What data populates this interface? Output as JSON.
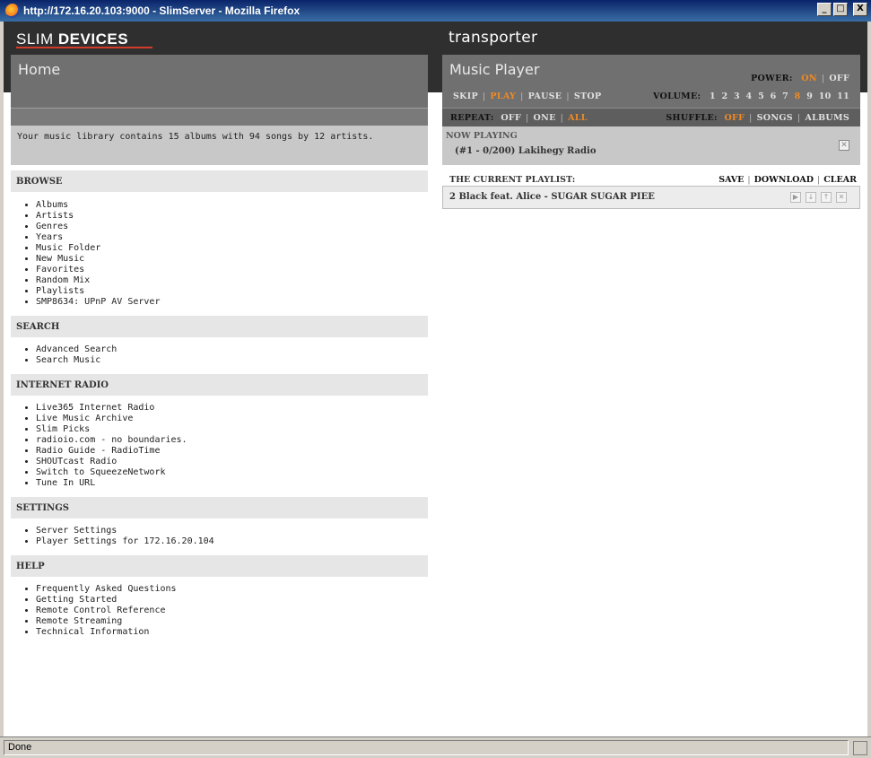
{
  "window": {
    "title": "http://172.16.20.103:9000 - SlimServer - Mozilla Firefox",
    "buttons": [
      "_",
      "□",
      "X"
    ]
  },
  "branding": {
    "logo_light": "SLIM ",
    "logo_bold": "DEVICES",
    "product": "transporter"
  },
  "home": {
    "title": "Home",
    "library_text": "Your music library contains 15 albums with 94 songs by 12 artists."
  },
  "sections": {
    "browse": {
      "title": "BROWSE",
      "items": [
        "Albums",
        "Artists",
        "Genres",
        "Years",
        "Music Folder",
        "New Music",
        "Favorites",
        "Random Mix",
        "Playlists",
        "SMP8634: UPnP AV Server"
      ]
    },
    "search": {
      "title": "SEARCH",
      "items": [
        "Advanced Search",
        "Search Music"
      ]
    },
    "internet_radio": {
      "title": "INTERNET RADIO",
      "items": [
        "Live365 Internet Radio",
        "Live Music Archive",
        "Slim Picks",
        "radioio.com - no boundaries.",
        "Radio Guide - RadioTime",
        "SHOUTcast Radio",
        "Switch to SqueezeNetwork",
        "Tune In URL"
      ]
    },
    "settings": {
      "title": "SETTINGS",
      "items": [
        "Server Settings",
        "Player Settings for 172.16.20.104"
      ]
    },
    "help": {
      "title": "HELP",
      "items": [
        "Frequently Asked Questions",
        "Getting Started",
        "Remote Control Reference",
        "Remote Streaming",
        "Technical Information"
      ]
    }
  },
  "player": {
    "title": "Music Player",
    "power": {
      "label": "POWER:",
      "on": "ON",
      "off": "OFF",
      "state": "on"
    },
    "transport": {
      "skip": "SKIP",
      "play": "PLAY",
      "pause": "PAUSE",
      "stop": "STOP",
      "active": "play"
    },
    "volume": {
      "label": "VOLUME:",
      "levels": [
        "1",
        "2",
        "3",
        "4",
        "5",
        "6",
        "7",
        "8",
        "9",
        "10",
        "11"
      ],
      "current": "8"
    },
    "repeat": {
      "label": "REPEAT:",
      "off": "OFF",
      "one": "ONE",
      "all": "ALL",
      "current": "all"
    },
    "shuffle": {
      "label": "SHUFFLE:",
      "off": "OFF",
      "songs": "SONGS",
      "albums": "ALBUMS",
      "current": "off"
    },
    "now_playing": {
      "label": "NOW PLAYING",
      "track": "(#1 - 0/200) Lakihegy Radio"
    },
    "playlist": {
      "label": "THE CURRENT PLAYLIST:",
      "save": "SAVE",
      "download": "DOWNLOAD",
      "clear": "CLEAR",
      "items": [
        "2 Black feat. Alice - SUGAR SUGAR PIEE"
      ]
    }
  },
  "status": {
    "text": "Done"
  },
  "colors": {
    "accent": "#f08a24",
    "header": "#707070",
    "topband": "#2f2f2f",
    "logo_red": "#d23b2a"
  }
}
